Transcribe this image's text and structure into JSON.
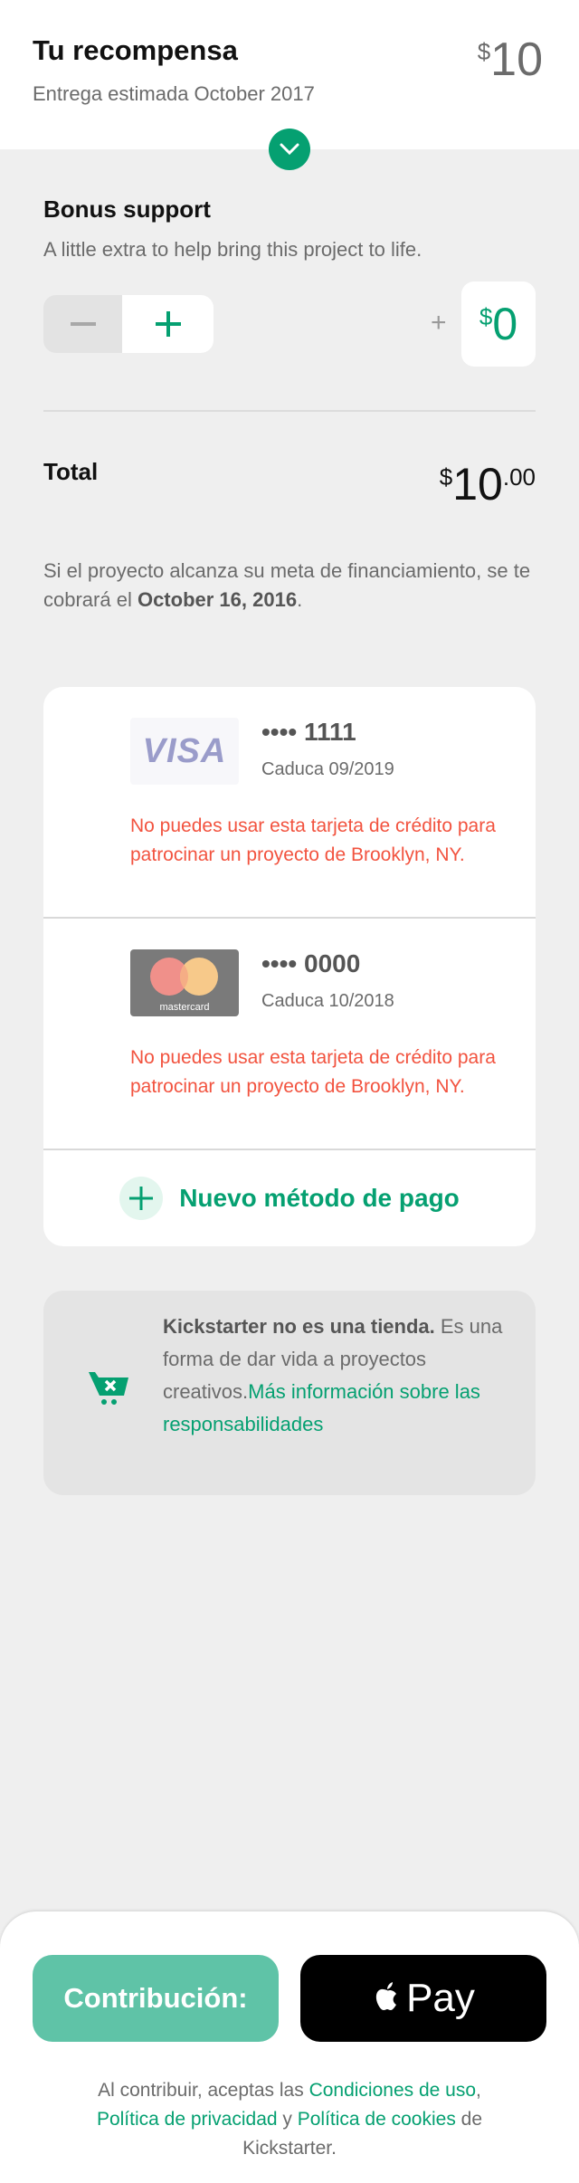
{
  "header": {
    "title": "Tu recompensa",
    "subtitle": "Entrega estimada October 2017",
    "price_symbol": "$",
    "price": "10"
  },
  "bonus": {
    "title": "Bonus support",
    "description": "A little extra to help bring this project to life.",
    "plus_sign": "+",
    "amount_symbol": "$",
    "amount": "0"
  },
  "total": {
    "label": "Total",
    "symbol": "$",
    "amount": "10",
    "cents": ".00"
  },
  "notice": {
    "text": "Si el proyecto alcanza su meta de financiamiento, se te cobrará el ",
    "date": "October 16, 2016",
    "end": "."
  },
  "cards": [
    {
      "brand": "VISA",
      "number": "•••• 1111",
      "expiry": "Caduca 09/2019",
      "error": "No puedes usar esta tarjeta de crédito para patrocinar un proyecto de Brooklyn, NY."
    },
    {
      "brand": "mastercard",
      "number": "•••• 0000",
      "expiry": "Caduca 10/2018",
      "error": "No puedes usar esta tarjeta de crédito para patrocinar un proyecto de Brooklyn, NY."
    }
  ],
  "new_payment": "Nuevo método de pago",
  "info": {
    "bold": "Kickstarter no es una tienda.",
    "text": " Es una forma de dar vida a proyectos creativos.",
    "link": "Más información sobre las responsabilidades"
  },
  "footer": {
    "contribute_label": "Contribución:",
    "apple_pay_label": "Pay",
    "terms": {
      "t1": "Al contribuir, aceptas las ",
      "l1": "Condiciones de uso",
      "t2": ", ",
      "l2": "Política de privacidad",
      "t3": " y ",
      "l3": "Política de cookies",
      "t4": " de Kickstarter."
    }
  },
  "colors": {
    "accent": "#05a071",
    "error": "#f2533f",
    "background": "#efefef"
  }
}
